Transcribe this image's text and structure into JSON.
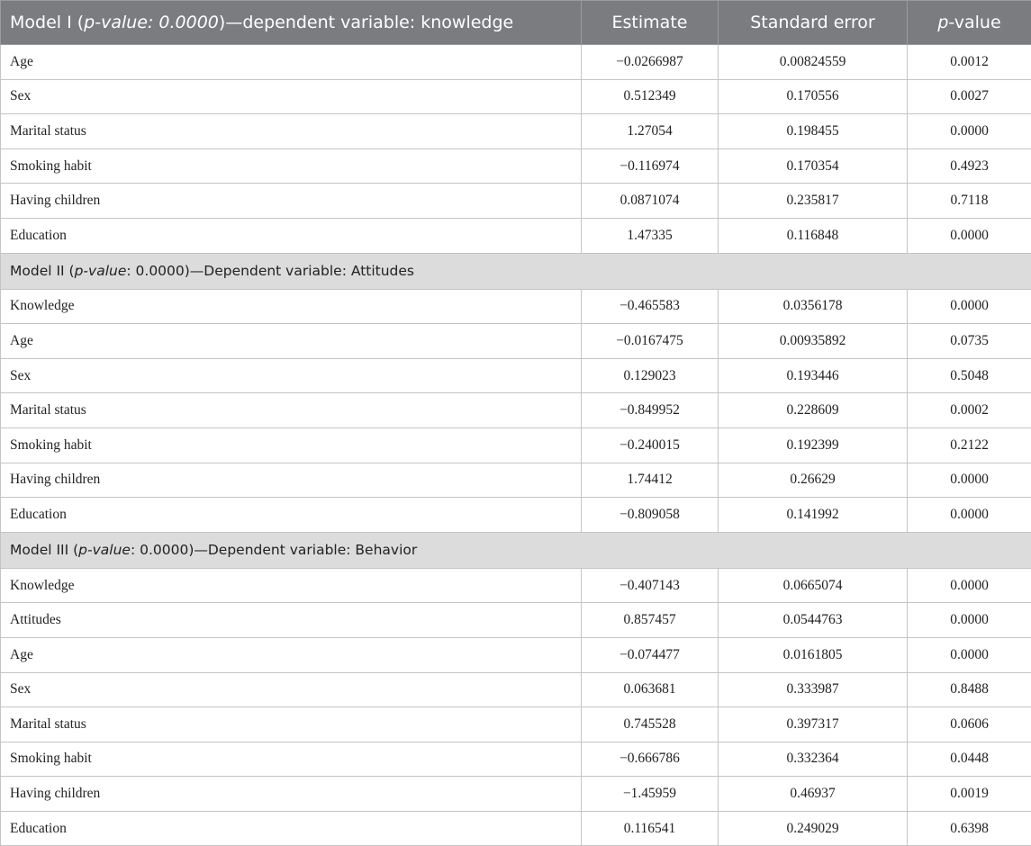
{
  "header": {
    "model1_prefix": "Model I (",
    "model1_pvalue": "p-value: 0.0000",
    "model1_suffix": ")—dependent variable: knowledge",
    "estimate": "Estimate",
    "standard_error": "Standard error",
    "pvalue_italic": "p",
    "pvalue_rest": "-value"
  },
  "models": [
    {
      "rows": [
        {
          "variable": "Age",
          "estimate": "−0.0266987",
          "se": "0.00824559",
          "p": "0.0012"
        },
        {
          "variable": "Sex",
          "estimate": "0.512349",
          "se": "0.170556",
          "p": "0.0027"
        },
        {
          "variable": "Marital status",
          "estimate": "1.27054",
          "se": "0.198455",
          "p": "0.0000"
        },
        {
          "variable": "Smoking habit",
          "estimate": "−0.116974",
          "se": "0.170354",
          "p": "0.4923"
        },
        {
          "variable": "Having children",
          "estimate": "0.0871074",
          "se": "0.235817",
          "p": "0.7118"
        },
        {
          "variable": "Education",
          "estimate": "1.47335",
          "se": "0.116848",
          "p": "0.0000"
        }
      ]
    },
    {
      "heading_prefix": "Model II (",
      "heading_italic": "p-value",
      "heading_suffix": ": 0.0000)—Dependent variable: Attitudes",
      "rows": [
        {
          "variable": "Knowledge",
          "estimate": "−0.465583",
          "se": "0.0356178",
          "p": "0.0000"
        },
        {
          "variable": "Age",
          "estimate": "−0.0167475",
          "se": "0.00935892",
          "p": "0.0735"
        },
        {
          "variable": "Sex",
          "estimate": "0.129023",
          "se": "0.193446",
          "p": "0.5048"
        },
        {
          "variable": "Marital status",
          "estimate": "−0.849952",
          "se": "0.228609",
          "p": "0.0002"
        },
        {
          "variable": "Smoking habit",
          "estimate": "−0.240015",
          "se": "0.192399",
          "p": "0.2122"
        },
        {
          "variable": "Having children",
          "estimate": "1.74412",
          "se": "0.26629",
          "p": "0.0000"
        },
        {
          "variable": "Education",
          "estimate": "−0.809058",
          "se": "0.141992",
          "p": "0.0000"
        }
      ]
    },
    {
      "heading_prefix": "Model III (",
      "heading_italic": "p-value",
      "heading_suffix": ": 0.0000)—Dependent variable: Behavior",
      "rows": [
        {
          "variable": "Knowledge",
          "estimate": "−0.407143",
          "se": "0.0665074",
          "p": "0.0000"
        },
        {
          "variable": "Attitudes",
          "estimate": "0.857457",
          "se": "0.0544763",
          "p": "0.0000"
        },
        {
          "variable": "Age",
          "estimate": "−0.074477",
          "se": "0.0161805",
          "p": "0.0000"
        },
        {
          "variable": "Sex",
          "estimate": "0.063681",
          "se": "0.333987",
          "p": "0.8488"
        },
        {
          "variable": "Marital status",
          "estimate": "0.745528",
          "se": "0.397317",
          "p": "0.0606"
        },
        {
          "variable": "Smoking habit",
          "estimate": "−0.666786",
          "se": "0.332364",
          "p": "0.0448"
        },
        {
          "variable": "Having children",
          "estimate": "−1.45959",
          "se": "0.46937",
          "p": "0.0019"
        },
        {
          "variable": "Education",
          "estimate": "0.116541",
          "se": "0.249029",
          "p": "0.6398"
        }
      ]
    }
  ]
}
